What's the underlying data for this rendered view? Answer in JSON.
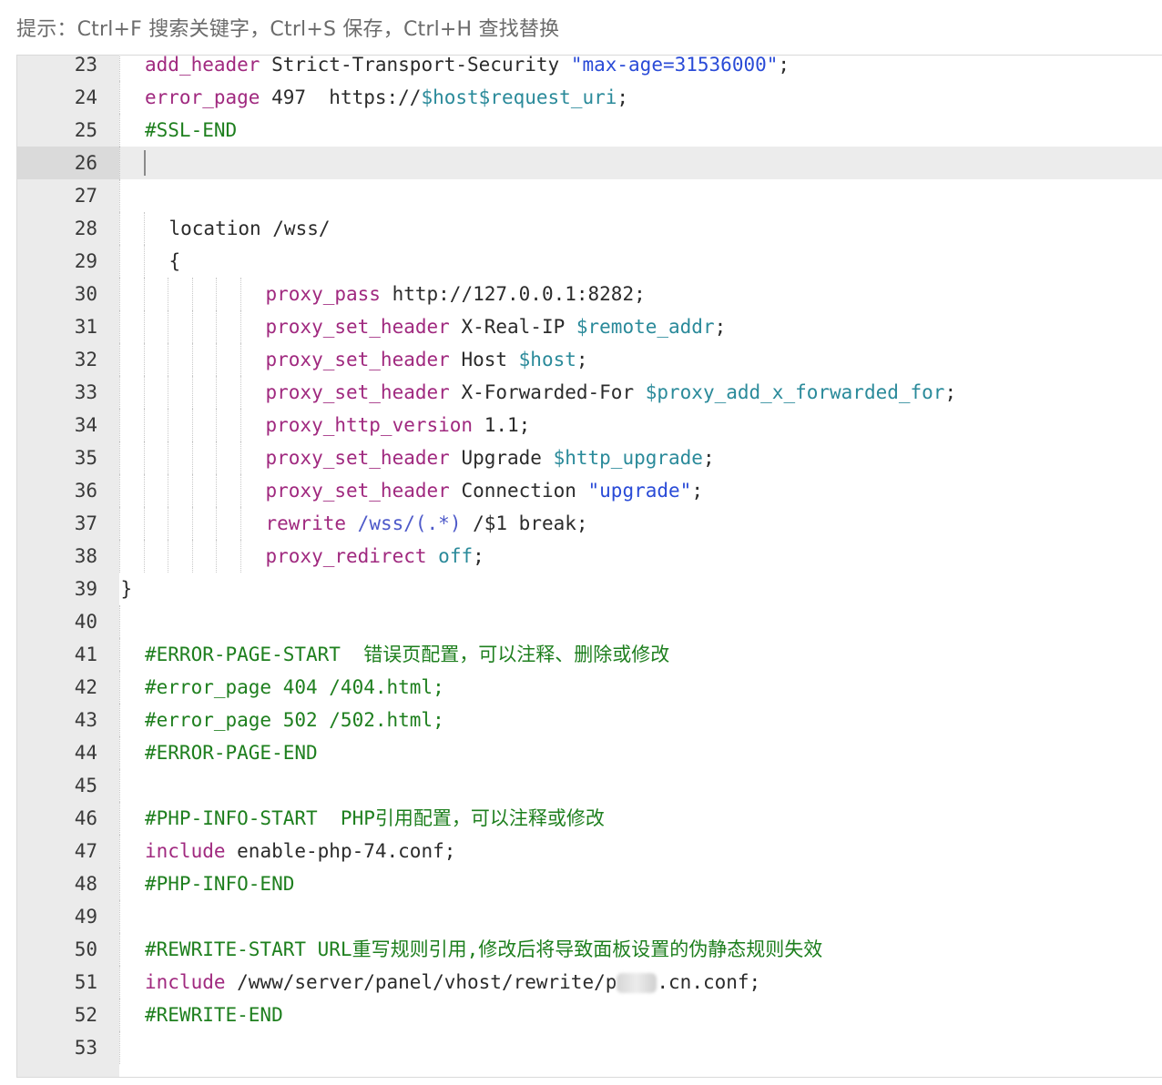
{
  "hint": "提示：Ctrl+F 搜索关键字，Ctrl+S 保存，Ctrl+H 查找替换",
  "editor": {
    "active_line": 26,
    "lines": [
      {
        "n": "23",
        "indent": 0,
        "tokens": [
          [
            "kw",
            "add_header"
          ],
          [
            "plain",
            " Strict-Transport-Security "
          ],
          [
            "str",
            "\"max-age=31536000\""
          ],
          [
            "plain",
            ";"
          ]
        ]
      },
      {
        "n": "24",
        "indent": 0,
        "tokens": [
          [
            "kw",
            "error_page"
          ],
          [
            "plain",
            " 497  https://"
          ],
          [
            "var",
            "$host$request_uri"
          ],
          [
            "plain",
            ";"
          ]
        ]
      },
      {
        "n": "25",
        "indent": 0,
        "tokens": [
          [
            "com",
            "#SSL-END"
          ]
        ]
      },
      {
        "n": "26",
        "indent": 0,
        "tokens": []
      },
      {
        "n": "27",
        "indent": 0,
        "tokens": []
      },
      {
        "n": "28",
        "indent": 1,
        "tokens": [
          [
            "plain",
            "location /wss/"
          ]
        ]
      },
      {
        "n": "29",
        "indent": 1,
        "tokens": [
          [
            "plain",
            "{"
          ]
        ]
      },
      {
        "n": "30",
        "indent": 5,
        "tokens": [
          [
            "kw",
            "proxy_pass"
          ],
          [
            "plain",
            " http://127.0.0.1:8282;"
          ]
        ]
      },
      {
        "n": "31",
        "indent": 5,
        "tokens": [
          [
            "kw",
            "proxy_set_header"
          ],
          [
            "plain",
            " X-Real-IP "
          ],
          [
            "var",
            "$remote_addr"
          ],
          [
            "plain",
            ";"
          ]
        ]
      },
      {
        "n": "32",
        "indent": 5,
        "tokens": [
          [
            "kw",
            "proxy_set_header"
          ],
          [
            "plain",
            " Host "
          ],
          [
            "var",
            "$host"
          ],
          [
            "plain",
            ";"
          ]
        ]
      },
      {
        "n": "33",
        "indent": 5,
        "tokens": [
          [
            "kw",
            "proxy_set_header"
          ],
          [
            "plain",
            " X-Forwarded-For "
          ],
          [
            "var",
            "$proxy_add_x_forwarded_for"
          ],
          [
            "plain",
            ";"
          ]
        ]
      },
      {
        "n": "34",
        "indent": 5,
        "tokens": [
          [
            "kw",
            "proxy_http_version"
          ],
          [
            "plain",
            " 1.1;"
          ]
        ]
      },
      {
        "n": "35",
        "indent": 5,
        "tokens": [
          [
            "kw",
            "proxy_set_header"
          ],
          [
            "plain",
            " Upgrade "
          ],
          [
            "var",
            "$http_upgrade"
          ],
          [
            "plain",
            ";"
          ]
        ]
      },
      {
        "n": "36",
        "indent": 5,
        "tokens": [
          [
            "kw",
            "proxy_set_header"
          ],
          [
            "plain",
            " Connection "
          ],
          [
            "str",
            "\"upgrade\""
          ],
          [
            "plain",
            ";"
          ]
        ]
      },
      {
        "n": "37",
        "indent": 5,
        "tokens": [
          [
            "kw",
            "rewrite"
          ],
          [
            "plain",
            " "
          ],
          [
            "re",
            "/wss/(.*)"
          ],
          [
            "plain",
            " /$1 break;"
          ]
        ]
      },
      {
        "n": "38",
        "indent": 5,
        "tokens": [
          [
            "kw",
            "proxy_redirect"
          ],
          [
            "plain",
            " "
          ],
          [
            "var",
            "off"
          ],
          [
            "plain",
            ";"
          ]
        ]
      },
      {
        "n": "39",
        "indent": -1,
        "tokens": [
          [
            "plain",
            "}"
          ]
        ]
      },
      {
        "n": "40",
        "indent": 0,
        "tokens": []
      },
      {
        "n": "41",
        "indent": 0,
        "tokens": [
          [
            "com",
            "#ERROR-PAGE-START  错误页配置，可以注释、删除或修改"
          ]
        ]
      },
      {
        "n": "42",
        "indent": 0,
        "tokens": [
          [
            "com",
            "#error_page 404 /404.html;"
          ]
        ]
      },
      {
        "n": "43",
        "indent": 0,
        "tokens": [
          [
            "com",
            "#error_page 502 /502.html;"
          ]
        ]
      },
      {
        "n": "44",
        "indent": 0,
        "tokens": [
          [
            "com",
            "#ERROR-PAGE-END"
          ]
        ]
      },
      {
        "n": "45",
        "indent": 0,
        "tokens": []
      },
      {
        "n": "46",
        "indent": 0,
        "tokens": [
          [
            "com",
            "#PHP-INFO-START  PHP引用配置，可以注释或修改"
          ]
        ]
      },
      {
        "n": "47",
        "indent": 0,
        "tokens": [
          [
            "kw",
            "include"
          ],
          [
            "plain",
            " enable-php-74.conf;"
          ]
        ]
      },
      {
        "n": "48",
        "indent": 0,
        "tokens": [
          [
            "com",
            "#PHP-INFO-END"
          ]
        ]
      },
      {
        "n": "49",
        "indent": 0,
        "tokens": []
      },
      {
        "n": "50",
        "indent": 0,
        "tokens": [
          [
            "com",
            "#REWRITE-START URL重写规则引用,修改后将导致面板设置的伪静态规则失效"
          ]
        ]
      },
      {
        "n": "51",
        "indent": 0,
        "tokens": [
          [
            "kw",
            "include"
          ],
          [
            "plain",
            " /www/server/panel/vhost/rewrite/p"
          ],
          [
            "blur",
            ""
          ],
          [
            "plain",
            ".cn.conf;"
          ]
        ]
      },
      {
        "n": "52",
        "indent": 0,
        "tokens": [
          [
            "com",
            "#REWRITE-END"
          ]
        ]
      },
      {
        "n": "53",
        "indent": 0,
        "tokens": []
      }
    ]
  }
}
